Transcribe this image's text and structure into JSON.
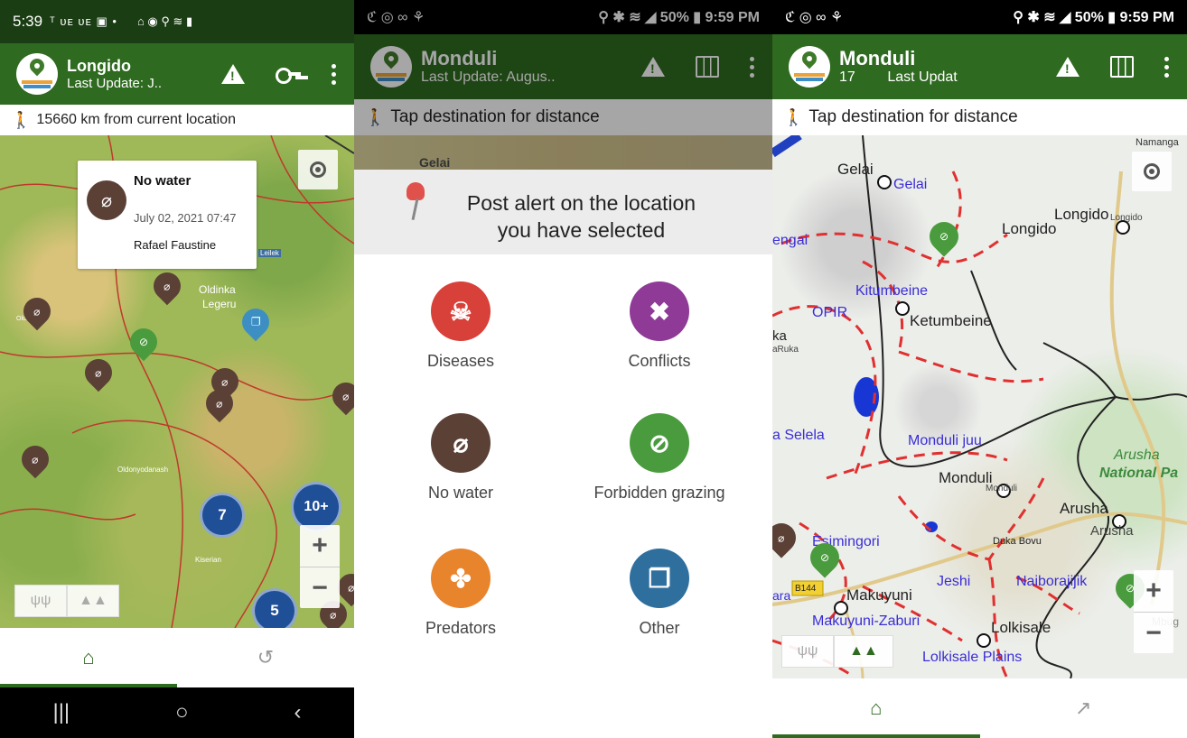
{
  "screen1": {
    "status": {
      "time": "5:39",
      "left_icons": "ᵀ ᴜᴇ ᴜᴇ ▣ •",
      "right_icons": "⌂ ◉ ⚲ ≋ ▮"
    },
    "appbar": {
      "title": "Longido",
      "subtitle": "Last Update: J.."
    },
    "distance": "15660 km from current location",
    "popup": {
      "title": "No water",
      "date": "July 02, 2021 07:47",
      "user": "Rafael Faustine"
    },
    "map_labels": {
      "oldinka": "Oldinka",
      "legeru": "Legeru",
      "leilek": "Leilek",
      "oldonyo": "Oldonyodanash",
      "kiserian": "Kiserian",
      "left": "Oldinka"
    },
    "clusters": [
      "7",
      "10+",
      "5"
    ],
    "zoom": {
      "in": "+",
      "out": "−"
    },
    "nav": {
      "home": "⌂",
      "history": "↺"
    },
    "android_nav": {
      "recents": "|||",
      "home": "○",
      "back": "‹"
    }
  },
  "screen2": {
    "status": {
      "left_icons": "ℭ ◎ ∞ ⚘",
      "right": "⚲ ✱ ≋ ◢ 50% ▮ 9:59 PM"
    },
    "appbar": {
      "title": "Monduli",
      "subtitle": "Last Update: Augus.."
    },
    "distance": "Tap destination for distance",
    "map_peek": "Gelai",
    "sheet_title_line1": "Post alert on the location",
    "sheet_title_line2": "you have selected",
    "options": [
      {
        "label": "Diseases",
        "color": "#d8403a",
        "glyph": "☠"
      },
      {
        "label": "Conflicts",
        "color": "#8e3a96",
        "glyph": "✖"
      },
      {
        "label": "No water",
        "color": "#5b4036",
        "glyph": "⌀"
      },
      {
        "label": "Forbidden grazing",
        "color": "#4a9b3e",
        "glyph": "⊘"
      },
      {
        "label": "Predators",
        "color": "#e8842c",
        "glyph": "✤"
      },
      {
        "label": "Other",
        "color": "#2f6f9e",
        "glyph": "❐"
      }
    ]
  },
  "screen3": {
    "status": {
      "left_icons": "ℭ ◎ ∞ ⚘",
      "right": "⚲ ✱ ≋ ◢ 50% ▮ 9:59 PM"
    },
    "appbar": {
      "title": "Monduli",
      "subtitle_a": "17",
      "subtitle_b": "Last Updat"
    },
    "distance": "Tap destination for distance",
    "map_labels": {
      "namanga": "Namanga",
      "gelai_town": "Gelai",
      "gelai_ward": "Gelai",
      "engai": "engai",
      "longido_town": "Longido",
      "longido_ward": "Longido",
      "longido_small": "Longido",
      "kitumbeine_ward": "Kitumbeine",
      "opir": "OPIR",
      "ketumbeine": "Ketumbeine",
      "ka": "ka",
      "karuka": "aRuka",
      "selela": "a Selela",
      "monduli_juu": "Monduli juu",
      "monduli_town": "Monduli",
      "monduli_small": "Monduli",
      "arusha_np1": "Arusha",
      "arusha_np2": "National Pa",
      "arusha_town": "Arusha",
      "arusha_small": "Arusha",
      "esimingori": "Esimingori",
      "duka_bovu": "Duka Bovu",
      "jeshi": "Jeshi",
      "naiborajijik": "Naiborajijik",
      "ara": "ara",
      "b144": "B144",
      "makuyuni": "Makuyuni",
      "makuyuni_zaburi": "Makuyuni-Zaburi",
      "lolkisale": "Lolkisale",
      "lolkisale_plains": "Lolkisale Plains",
      "mbug": "Mbug"
    },
    "zoom": {
      "in": "+",
      "out": "−"
    },
    "nav": {
      "home": "⌂",
      "trend": "↗"
    }
  }
}
